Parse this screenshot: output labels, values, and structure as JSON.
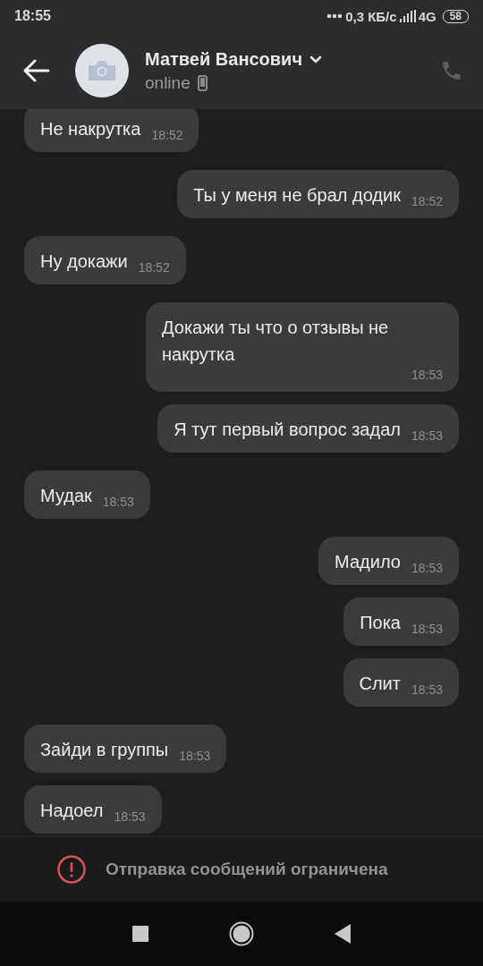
{
  "status_bar": {
    "time": "18:55",
    "speed": "0,3 КБ/с",
    "network": "4G",
    "battery": "58"
  },
  "header": {
    "name": "Матвей Вансович",
    "status": "online"
  },
  "messages": [
    {
      "kind": "incoming",
      "text": "Не накрутка",
      "time": "18:52"
    },
    {
      "kind": "outgoing",
      "text": "Ты у меня не брал додик",
      "time": "18:52"
    },
    {
      "kind": "incoming",
      "text": "Ну докажи",
      "time": "18:52"
    },
    {
      "kind": "outgoing",
      "text": "Докажи ты что о отзывы не накрутка",
      "time": "18:53"
    },
    {
      "kind": "outgoing",
      "text": "Я тут первый вопрос задал",
      "time": "18:53"
    },
    {
      "kind": "incoming",
      "text": "Мудак",
      "time": "18:53"
    },
    {
      "kind": "outgoing",
      "text": "Мадило",
      "time": "18:53"
    },
    {
      "kind": "outgoing",
      "text": "Пока",
      "time": "18:53"
    },
    {
      "kind": "outgoing",
      "text": "Слит",
      "time": "18:53"
    },
    {
      "kind": "incoming",
      "text": "Зайди в группы",
      "time": "18:53"
    },
    {
      "kind": "incoming",
      "text": "Надоел",
      "time": "18:53"
    }
  ],
  "notice": {
    "text": "Отправка сообщений ограничена"
  }
}
